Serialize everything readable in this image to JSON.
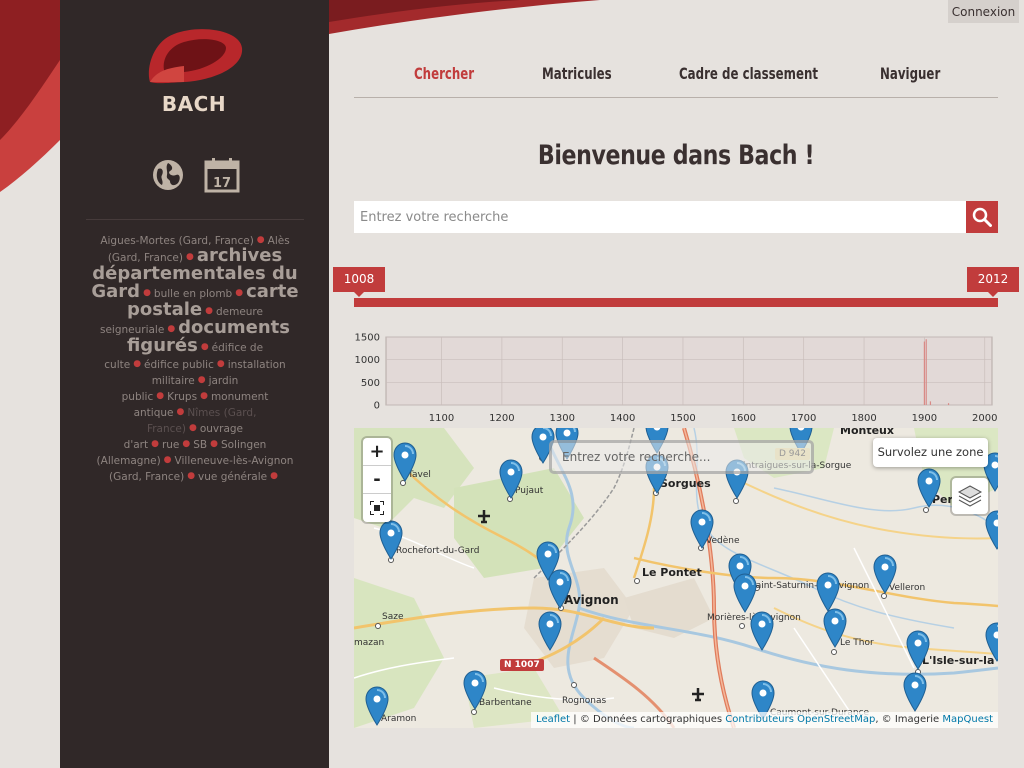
{
  "header": {
    "login_label": "Connexion"
  },
  "logo": {
    "text": "BACH"
  },
  "sidebar": {
    "tags": [
      {
        "label": "Aigues-Mortes (Gard, France)",
        "size": "small"
      },
      {
        "label": "Alès (Gard, France)",
        "size": "small"
      },
      {
        "label": "archives départementales du Gard",
        "size": "large"
      },
      {
        "label": "bulle en plomb",
        "size": "small"
      },
      {
        "label": "carte postale",
        "size": "large"
      },
      {
        "label": "demeure seigneuriale",
        "size": "small"
      },
      {
        "label": "documents figurés",
        "size": "large"
      },
      {
        "label": "édifice de culte",
        "size": "small"
      },
      {
        "label": "édifice public",
        "size": "small"
      },
      {
        "label": "installation militaire",
        "size": "small"
      },
      {
        "label": "jardin public",
        "size": "small"
      },
      {
        "label": "Krups",
        "size": "small"
      },
      {
        "label": "monument antique",
        "size": "small"
      },
      {
        "label": "Nîmes (Gard, France)",
        "size": "small"
      },
      {
        "label": "ouvrage d'art",
        "size": "small"
      },
      {
        "label": "rue",
        "size": "small"
      },
      {
        "label": "SB",
        "size": "small"
      },
      {
        "label": "Solingen (Allemagne)",
        "size": "small"
      },
      {
        "label": "Villeneuve-lès-Avignon (Gard, France)",
        "size": "small"
      },
      {
        "label": "vue générale",
        "size": "small"
      }
    ],
    "icons": [
      "globe-icon",
      "calendar-icon"
    ],
    "calendar_day": "17"
  },
  "nav": {
    "items": [
      "Chercher",
      "Matricules",
      "Cadre de classement",
      "Naviguer"
    ],
    "active": "Chercher"
  },
  "main": {
    "welcome": "Bienvenue dans Bach !",
    "search_placeholder": "Entrez votre recherche"
  },
  "range": {
    "start": "1008",
    "end": "2012"
  },
  "histogram": {
    "type": "bar",
    "y_ticks": [
      "1500",
      "1000",
      "500",
      "0"
    ],
    "x_ticks": [
      "1100",
      "1200",
      "1300",
      "1400",
      "1500",
      "1600",
      "1700",
      "1800",
      "1900",
      "2000"
    ],
    "ylim": [
      0,
      1500
    ],
    "xlim": [
      1008,
      2012
    ],
    "bars": [
      {
        "x": 1900,
        "y": 1400
      },
      {
        "x": 1903,
        "y": 1450
      },
      {
        "x": 1910,
        "y": 80
      },
      {
        "x": 1940,
        "y": 40
      }
    ]
  },
  "chart_data": {
    "type": "bar",
    "x": [
      1900,
      1903,
      1910,
      1940
    ],
    "values": [
      1400,
      1450,
      80,
      40
    ],
    "xlim": [
      1008,
      2012
    ],
    "ylim": [
      0,
      1500
    ],
    "x_ticks": [
      "1100",
      "1200",
      "1300",
      "1400",
      "1500",
      "1600",
      "1700",
      "1800",
      "1900",
      "2000"
    ],
    "y_ticks": [
      "0",
      "500",
      "1000",
      "1500"
    ]
  },
  "map": {
    "search_placeholder": "Entrez votre recherche...",
    "hover_hint": "Survolez une zone",
    "zoom_in": "+",
    "zoom_out": "-",
    "road_badge": "N 1007",
    "road_badge_2": "D 942",
    "places": [
      "Tavel",
      "Pujaut",
      "Sorgues",
      "Monteux",
      "Entraigues-sur-la-Sorgue",
      "Pernes",
      "Rochefort-du-Gard",
      "Vedène",
      "Le Pontet",
      "Avignon",
      "Saint-Saturnin-lès-Avignon",
      "Velleron",
      "Saze",
      "Morières-lès-Avignon",
      "Le Thor",
      "L'Isle-sur-la",
      "Aramon",
      "Barbentane",
      "Rognonas",
      "Caumont-sur-Durance",
      "mazan"
    ],
    "attribution": {
      "leaflet": "Leaflet",
      "data_text": " | © Données cartographiques ",
      "osm": "Contributeurs OpenStreetMap",
      "imagery_text": ", © Imagerie ",
      "mapquest": "MapQuest"
    }
  },
  "colors": {
    "accent": "#c13c3c",
    "sidebar": "#302828",
    "background": "#e6e2de",
    "marker": "#3a8fd0"
  }
}
